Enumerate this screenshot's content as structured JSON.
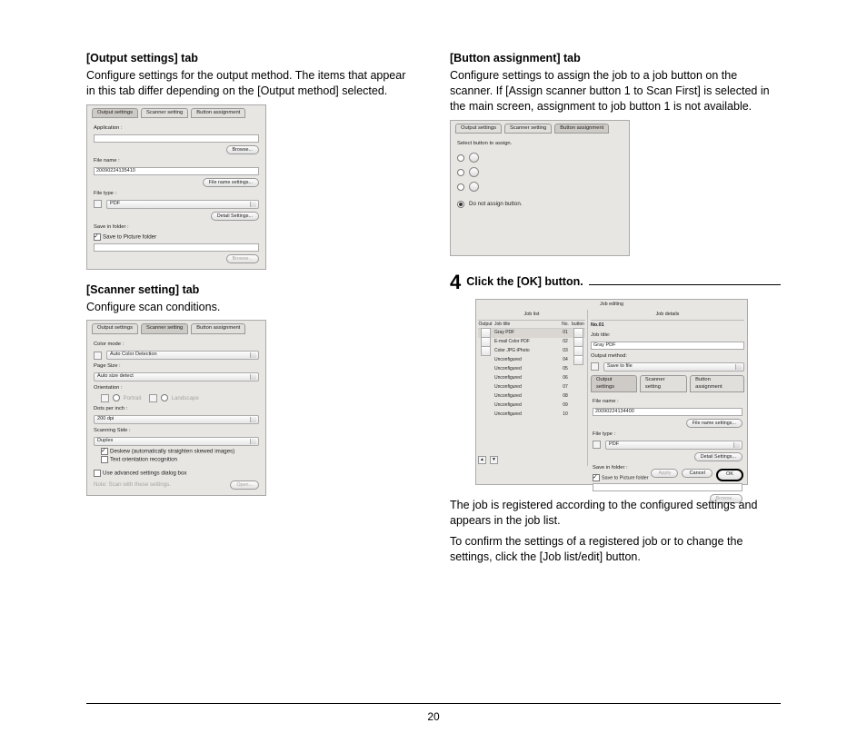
{
  "page_number": "20",
  "left": {
    "output_tab": {
      "heading": "[Output settings] tab",
      "desc": "Configure settings for the output method. The items that appear in this tab differ depending on the [Output method] selected.",
      "tabs": [
        "Output settings",
        "Scanner setting",
        "Button assignment"
      ],
      "labels": {
        "application": "Application :",
        "browse": "Browse...",
        "file_name": "File name :",
        "file_name_value": "20090224135410",
        "file_name_settings": "File name settings...",
        "file_type": "File type :",
        "file_type_value": " PDF",
        "detail_settings": "Detail Settings...",
        "save_in_folder": "Save in folder :",
        "save_to_picture": "Save to Picture folder",
        "browse2": "Browse..."
      }
    },
    "scanner_tab": {
      "heading": "[Scanner setting] tab",
      "desc": "Configure scan conditions.",
      "labels": {
        "color_mode": "Color mode :",
        "color_mode_value": "Auto Color Detection",
        "page_size": "Page Size :",
        "page_size_value": "Auto size detect",
        "orientation": "Orientation :",
        "portrait": "Portrait",
        "landscape": "Landscape",
        "dpi": "Dots per inch :",
        "dpi_value": "200 dpi",
        "scanning_side": "Scanning Side :",
        "scanning_side_value": "Duplex",
        "deskew": "Deskew (automatically straighten skewed images)",
        "text_orient": "Text orientation recognition",
        "use_adv": "Use advanced settings dialog box",
        "note": "Note: Scan with these settings.",
        "open": "Open..."
      }
    }
  },
  "right": {
    "button_tab": {
      "heading": "[Button assignment] tab",
      "desc": "Configure settings to assign the job to a job button on the scanner. If [Assign scanner button 1 to Scan First] is selected in the main screen, assignment to job button 1 is not available.",
      "select_prompt": "Select button to assign.",
      "do_not_assign": "Do not assign button."
    },
    "step4": {
      "num": "4",
      "text": "Click the [OK] button.",
      "after1": "The job is registered according to the configured settings and appears in the job list.",
      "after2": "To confirm the settings of a registered job or to change the settings, click the [Job list/edit] button."
    },
    "jobedit": {
      "title": "Job editing",
      "joblist_header": "Job list",
      "jobdetails_header": "Job details",
      "cols": {
        "output": "Output",
        "title": "Job title",
        "no": "No.",
        "button": "button"
      },
      "jobs": [
        {
          "title": "Gray PDF",
          "no": "01",
          "sel": true
        },
        {
          "title": "E-mail Color PDF",
          "no": "02"
        },
        {
          "title": "Color JPG iPhoto",
          "no": "03"
        },
        {
          "title": "Unconfigured",
          "no": "04"
        },
        {
          "title": "Unconfigured",
          "no": "05"
        },
        {
          "title": "Unconfigured",
          "no": "06"
        },
        {
          "title": "Unconfigured",
          "no": "07"
        },
        {
          "title": "Unconfigured",
          "no": "08"
        },
        {
          "title": "Unconfigured",
          "no": "09"
        },
        {
          "title": "Unconfigured",
          "no": "10"
        }
      ],
      "details": {
        "no_label": "No.01",
        "job_title_lbl": "Job title:",
        "job_title_val": "Gray PDF",
        "output_method_lbl": "Output method:",
        "output_method_val": " Save to file",
        "tabs": [
          "Output settings",
          "Scanner setting",
          "Button assignment"
        ],
        "file_name_lbl": "File name :",
        "file_name_val": "20090224134400",
        "file_name_settings": "File name settings...",
        "file_type_lbl": "File type :",
        "file_type_val": " PDF",
        "detail_settings": "Detail Settings...",
        "save_folder_lbl": "Save in folder :",
        "save_to_picture": "Save to Picture folder",
        "browse": "Browse..."
      },
      "buttons": {
        "apply": "Apply",
        "cancel": "Cancel",
        "ok": "OK"
      }
    }
  }
}
